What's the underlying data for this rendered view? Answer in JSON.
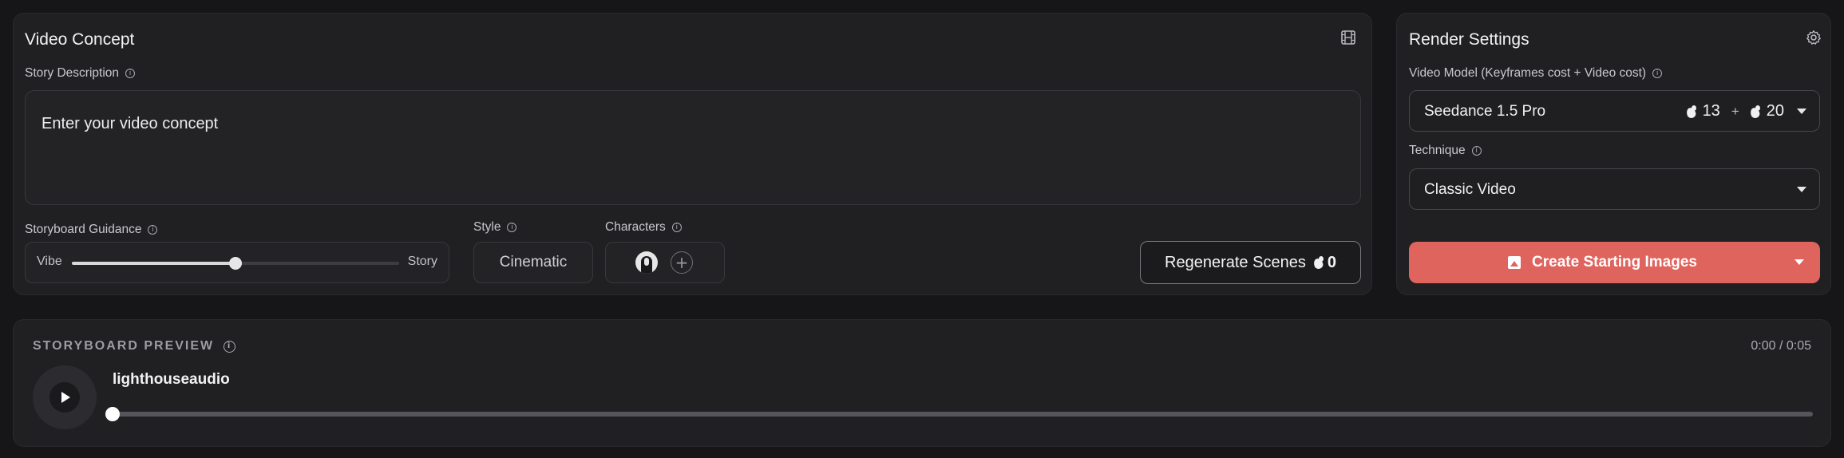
{
  "concept": {
    "title": "Video Concept",
    "story_label": "Story Description",
    "story_placeholder": "Enter your video concept",
    "guidance": {
      "label": "Storyboard Guidance",
      "left": "Vibe",
      "right": "Story",
      "value_fraction": 0.5
    },
    "style": {
      "label": "Style",
      "value": "Cinematic"
    },
    "characters": {
      "label": "Characters"
    },
    "regenerate": {
      "label": "Regenerate Scenes",
      "cost": "0"
    }
  },
  "render": {
    "title": "Render Settings",
    "model_label": "Video Model (Keyframes cost + Video cost)",
    "model_value": "Seedance 1.5 Pro",
    "keyframes_cost": "13",
    "plus": "+",
    "video_cost": "20",
    "technique_label": "Technique",
    "technique_value": "Classic Video",
    "create_label": "Create Starting Images"
  },
  "preview": {
    "title": "STORYBOARD PREVIEW",
    "time": "0:00 / 0:05",
    "track_name": "lighthouseaudio",
    "progress_fraction": 0
  },
  "icons": {
    "concept": "film-icon",
    "render": "gear-icon",
    "create": "image-icon",
    "credits": "credit-icon"
  },
  "colors": {
    "accent": "#e0645e",
    "panel": "#202023",
    "background": "#161618"
  }
}
